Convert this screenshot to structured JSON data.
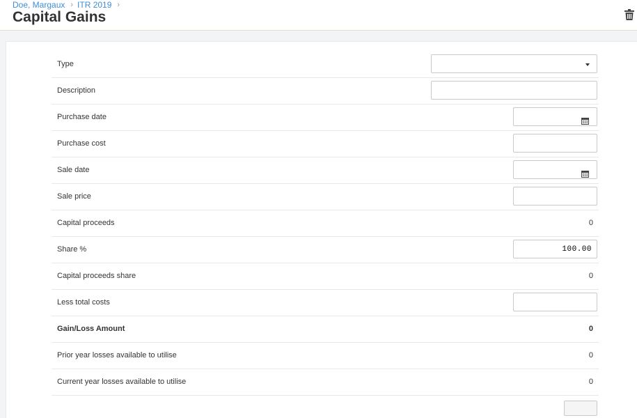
{
  "breadcrumb": {
    "client": "Doe, Margaux",
    "return": "ITR 2019",
    "sep": "›"
  },
  "page_title": "Capital Gains",
  "form": {
    "type": {
      "label": "Type",
      "value": ""
    },
    "description": {
      "label": "Description",
      "value": ""
    },
    "purchase_date": {
      "label": "Purchase date",
      "value": ""
    },
    "purchase_cost": {
      "label": "Purchase cost",
      "value": ""
    },
    "sale_date": {
      "label": "Sale date",
      "value": ""
    },
    "sale_price": {
      "label": "Sale price",
      "value": ""
    },
    "capital_proceeds": {
      "label": "Capital proceeds",
      "value": "0"
    },
    "share_pct": {
      "label": "Share %",
      "value": "100.00"
    },
    "capital_proceeds_share": {
      "label": "Capital proceeds share",
      "value": "0"
    },
    "less_total_costs": {
      "label": "Less total costs",
      "value": ""
    },
    "gain_loss": {
      "label": "Gain/Loss Amount",
      "value": "0"
    },
    "prior_year_losses": {
      "label": "Prior year losses available to utilise",
      "value": "0"
    },
    "current_year_losses": {
      "label": "Current year losses available to utilise",
      "value": "0"
    }
  },
  "icons": {
    "delete": "trash-icon",
    "calendar": "calendar-icon",
    "dropdown": "caret-down-icon"
  },
  "colors": {
    "link": "#3d8ed6",
    "header_border": "#eadfc9"
  }
}
